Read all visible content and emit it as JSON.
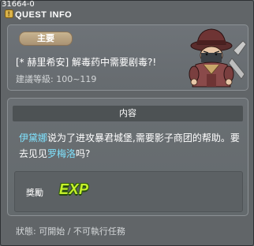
{
  "window": {
    "quest_id": "31664-0",
    "title": "QUEST INFO"
  },
  "quest": {
    "badge": "主要",
    "title": "[* 赫里希安] 解毒药中需要剧毒?!",
    "level": "建議等級: 100~119"
  },
  "content": {
    "header": "内容",
    "desc_part1": "伊黛娜",
    "desc_part2": "说为了进攻暴君城堡,需要影子商团的帮助。要去见见",
    "desc_part3": "罗梅洛",
    "desc_part4": "吗?",
    "highlight_color": "#7fe3ff"
  },
  "reward": {
    "label": "獎勵",
    "exp": "EXP"
  },
  "status": {
    "text": "狀態: 可開始 / 不可執行任務"
  }
}
